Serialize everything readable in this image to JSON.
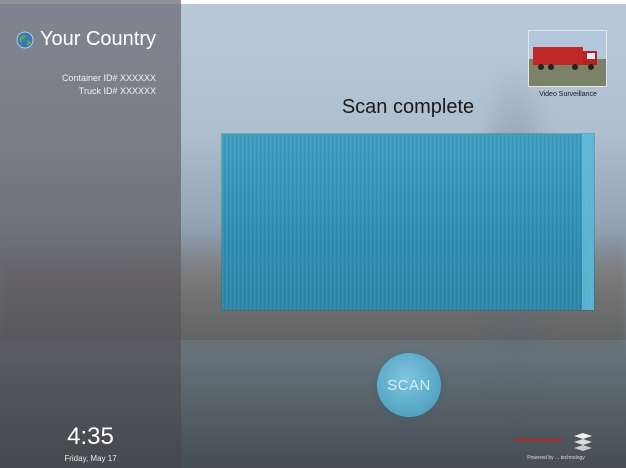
{
  "header": {
    "country": "Your Country"
  },
  "ids": {
    "container": "Container ID# XXXXXX",
    "truck": "Truck ID# XXXXXX"
  },
  "clock": {
    "time": "4:35",
    "date": "Friday, May 17"
  },
  "video": {
    "label": "Video Surveillance"
  },
  "scan": {
    "status": "Scan complete",
    "button_label": "SCAN"
  },
  "footer": {
    "powered_by": "Powered by ... technology"
  },
  "icons": {
    "globe": "globe-icon",
    "truck_thumbnail": "truck-thumbnail",
    "brand_logo": "brand-logo-icon"
  },
  "colors": {
    "accent": "#3e9ec1",
    "scan_button": "#5aa9c8",
    "brand_red": "#c42020"
  }
}
